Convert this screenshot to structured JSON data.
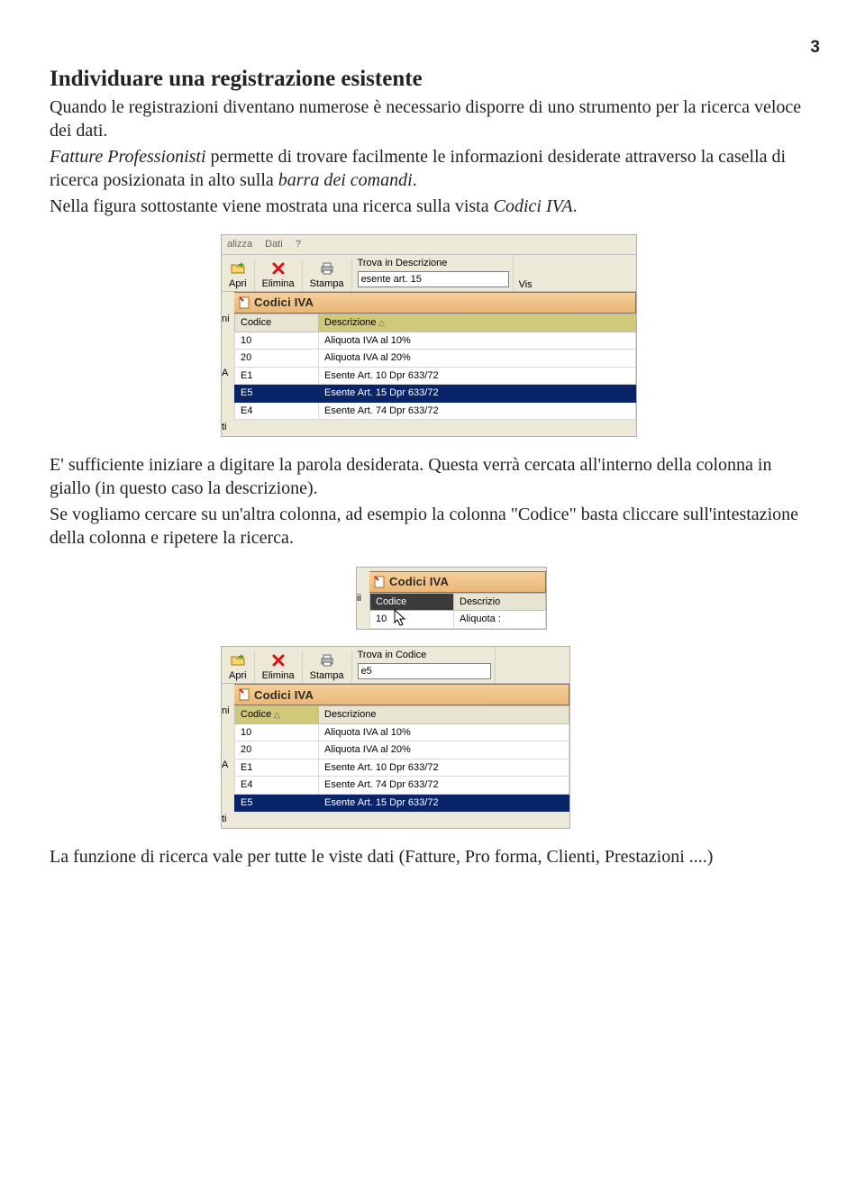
{
  "page": {
    "number": "3",
    "heading": "Individuare una registrazione esistente",
    "p1": "Quando le registrazioni diventano numerose è necessario disporre di uno strumento per la ricerca veloce dei dati.",
    "p2a": "Fatture Professionisti",
    "p2b": " permette di trovare facilmente le informazioni desiderate attraverso la casella di ricerca posizionata in alto sulla ",
    "p2c": "barra dei comandi",
    "p2d": ".",
    "p3a": "Nella figura sottostante viene mostrata una ricerca sulla vista ",
    "p3b": "Codici IVA",
    "p3c": ".",
    "p4": "E' sufficiente iniziare a digitare la parola desiderata. Questa verrà cercata all'interno della colonna in giallo (in questo caso la descrizione).",
    "p5": "Se vogliamo cercare su un'altra colonna, ad esempio la colonna \"Codice\" basta cliccare sull'intestazione della colonna e ripetere la ricerca.",
    "p6": "La funzione di ricerca vale per tutte le viste dati (Fatture, Pro forma, Clienti, Prestazioni ....)"
  },
  "shot1": {
    "menu": [
      "alizza",
      "Dati",
      "?"
    ],
    "tools": {
      "apri": "Apri",
      "elimina": "Elimina",
      "stampa": "Stampa"
    },
    "search_label": "Trova in Descrizione",
    "search_value": "esente art. 15",
    "extra": "Vis",
    "title": "Codici IVA",
    "left": [
      "ni",
      "",
      "A",
      "",
      "ti"
    ],
    "cols": [
      "Codice",
      "Descrizione"
    ],
    "rows": [
      {
        "c": "10",
        "d": "Aliquota IVA al 10%"
      },
      {
        "c": "20",
        "d": "Aliquota IVA al 20%"
      },
      {
        "c": "E1",
        "d": "Esente Art. 10 Dpr 633/72"
      },
      {
        "c": "E5",
        "d": "Esente Art. 15 Dpr 633/72",
        "sel": true
      },
      {
        "c": "E4",
        "d": "Esente Art. 74 Dpr 633/72"
      }
    ]
  },
  "shot2": {
    "title": "Codici IVA",
    "left": [
      "ii",
      ""
    ],
    "cols": [
      "Codice",
      "Descrizio"
    ],
    "row": {
      "c": "10",
      "d": "Aliquota :"
    }
  },
  "shot3": {
    "tools": {
      "apri": "Apri",
      "elimina": "Elimina",
      "stampa": "Stampa"
    },
    "search_label": "Trova in Codice",
    "search_value": "e5",
    "title": "Codici IVA",
    "left": [
      "ni",
      "",
      "A",
      "",
      "ti"
    ],
    "cols": [
      "Codice",
      "Descrizione"
    ],
    "rows": [
      {
        "c": "10",
        "d": "Aliquota IVA al 10%"
      },
      {
        "c": "20",
        "d": "Aliquota IVA al 20%"
      },
      {
        "c": "E1",
        "d": "Esente Art. 10 Dpr 633/72"
      },
      {
        "c": "E4",
        "d": "Esente Art. 74 Dpr 633/72"
      },
      {
        "c": "E5",
        "d": "Esente Art. 15 Dpr 633/72",
        "sel": true
      }
    ]
  }
}
